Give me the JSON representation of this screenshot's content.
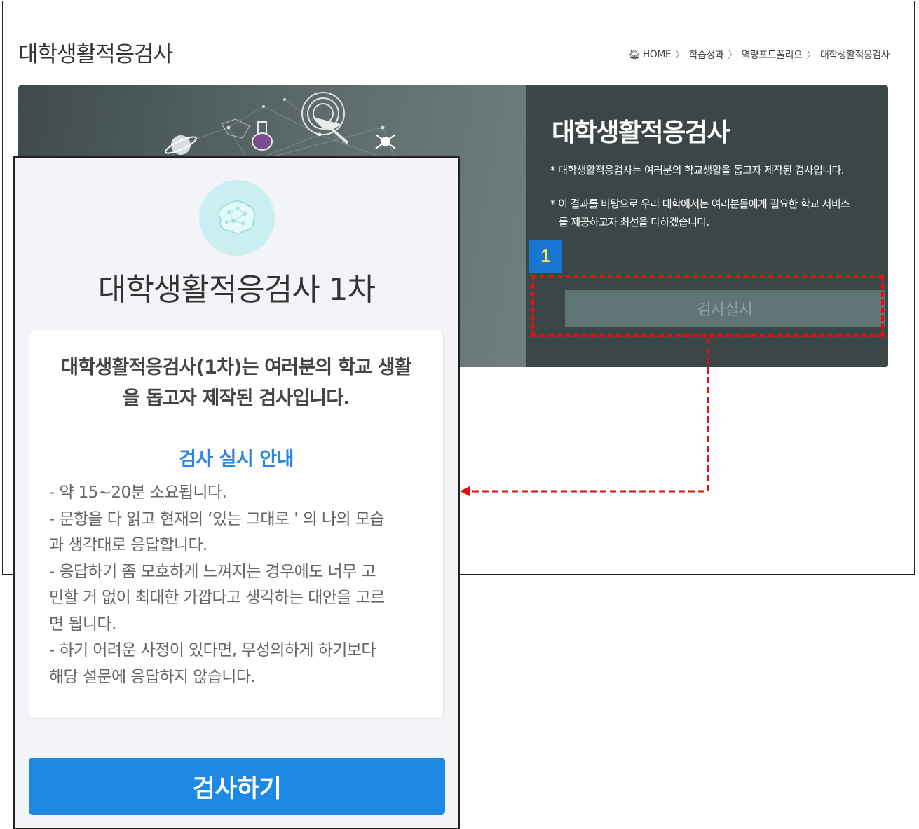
{
  "page": {
    "title": "대학생활적응검사",
    "breadcrumb": {
      "home": "HOME",
      "items": [
        "학습성과",
        "역량포트폴리오",
        "대학생활적응검사"
      ],
      "separator": "〉"
    }
  },
  "banner": {
    "heading": "대학생활적응검사",
    "desc1": "* 대학생활적응검사는 여러분의 학교생활을 돕고자 제작된 검사입니다.",
    "desc2_line1": "* 이 결과를 바탕으로 우리 대학에서는 여러분들에게 필요한 학교 서비스",
    "desc2_line2": "를 제공하고자 최선을 다하겠습니다.",
    "button_label": "검사실시"
  },
  "callout": {
    "number": "1"
  },
  "mobile": {
    "title": "대학생활적응검사 1차",
    "card": {
      "headline_line1": "대학생활적응검사(1차)는 여러분의 학교 생활",
      "headline_line2": "을 돕고자 제작된 검사입니다.",
      "subheading": "검사 실시 안내",
      "guide_lines": [
        "- 약 15~20분 소요됩니다.",
        "- 문항을 다 읽고 현재의 ‘있는 그대로 ' 의 나의 모습",
        "과 생각대로 응답합니다.",
        "- 응답하기 좀 모호하게 느껴지는 경우에도 너무 고",
        "민할 거 없이 최대한 가깝다고 생각하는 대안을 고르",
        "면 됩니다.",
        "- 하기 어려운 사정이 있다면, 무성의하게 하기보다",
        "해당 설문에 응답하지 않습니다."
      ]
    },
    "button_label": "검사하기"
  },
  "colors": {
    "primary_blue": "#1e88e5",
    "subheading_blue": "#2d86e5",
    "callout_red": "#e01010",
    "badge_blue": "#1976d2",
    "badge_text": "#ffeb3b",
    "banner_dark": "#3b4647"
  },
  "icons": {
    "home": "home-icon",
    "brain": "brain-icon"
  }
}
